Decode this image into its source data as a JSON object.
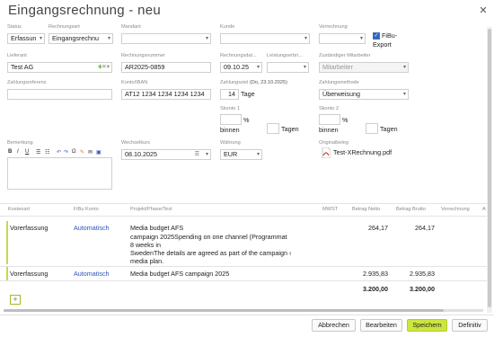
{
  "window": {
    "title": "Eingangsrechnung - neu"
  },
  "fields": {
    "status": {
      "label": "Status",
      "value": "Erfassun"
    },
    "rechnungsart": {
      "label": "Rechnungsart",
      "value": "Eingangsrechnu"
    },
    "mandant": {
      "label": "Mandant",
      "value": ""
    },
    "kunde": {
      "label": "Kunde",
      "value": ""
    },
    "verrechnung": {
      "label": "Verrechnung",
      "value": ""
    },
    "fibu_export": {
      "label": "FiBu-Export",
      "label_line1": "FiBu-",
      "label_line2": "Export",
      "checked": true
    },
    "lieferant": {
      "label": "Lieferant",
      "value": "Test AG"
    },
    "rechnungsnummer": {
      "label": "Rechnungsnummer",
      "value": "AR2025-0859"
    },
    "rechnungsdatum": {
      "label": "Rechnungsdat...",
      "value": "09.10.25"
    },
    "leistungserbr": {
      "label": "Leistungserbri...",
      "value": ""
    },
    "zustaendiger_mitarbeiter": {
      "label": "Zuständiger Mitarbeiter",
      "value": "Mitarbeiter"
    },
    "zahlungsreferenz": {
      "label": "Zahlungsreferenz",
      "value": ""
    },
    "konto_iban": {
      "label": "Konto/IBAN",
      "value": "AT12 1234 1234 1234 1234"
    },
    "zahlungsziel": {
      "label": "Zahlungsziel",
      "hint": "(Do, 23.10.2025)",
      "value": "14",
      "unit": "Tage"
    },
    "zahlungsmethode": {
      "label": "Zahlungsmethode",
      "value": "Überweisung"
    },
    "skonto1": {
      "label": "Skonto 1",
      "percent": "%",
      "binnen": "binnen",
      "tagen": "Tagen"
    },
    "skonto2": {
      "label": "Skonto 2",
      "percent": "%",
      "binnen": "binnen",
      "tagen": "Tagen"
    },
    "bemerkung": {
      "label": "Bemerkung"
    },
    "wechselkurs": {
      "label": "Wechselkurs",
      "value": "08.10.2025"
    },
    "waehrung": {
      "label": "Währung",
      "value": "EUR"
    },
    "originalbeleg": {
      "label": "Originalbeleg",
      "file": "Test-XRechnung.pdf"
    }
  },
  "toolbar": {
    "bold": "B",
    "italic": "I",
    "underline": "U",
    "omega": "Ω"
  },
  "table": {
    "headers": {
      "kostenart": "Kostenart",
      "fibu_konto": "FiBu Konto",
      "projekt": "Projekt/Phase/Text",
      "mwst": "MWST",
      "netto": "Betrag Netto",
      "brutto": "Betrag Brutto",
      "verrechnung": "Verrechnung",
      "extra": "A"
    },
    "rows": [
      {
        "kostenart": "Vorerfassung",
        "fibu_konto": "Automatisch",
        "text_lines": [
          "Media budget AFS",
          "campaign 2025Spending on one channel (Programmat",
          "8 weeks in",
          "SwedenThe details are agreed as part of the campaign ‹",
          "media plan."
        ],
        "netto": "264,17",
        "brutto": "264,17"
      },
      {
        "kostenart": "Vorerfassung",
        "fibu_konto": "Automatisch",
        "text_lines": [
          "Media budget AFS campaign 2025"
        ],
        "netto": "2.935,83",
        "brutto": "2.935,83"
      }
    ],
    "totals": {
      "netto": "3.200,00",
      "brutto": "3.200,00"
    },
    "add_label": "+"
  },
  "buttons": {
    "abbrechen": "Abbrechen",
    "bearbeiten": "Bearbeiten",
    "speichern": "Speichern",
    "definitiv": "Definitiv"
  },
  "colors": {
    "accent_green": "#cde63f",
    "link_blue": "#2d54b8",
    "row_marker": "#c8d94a"
  }
}
